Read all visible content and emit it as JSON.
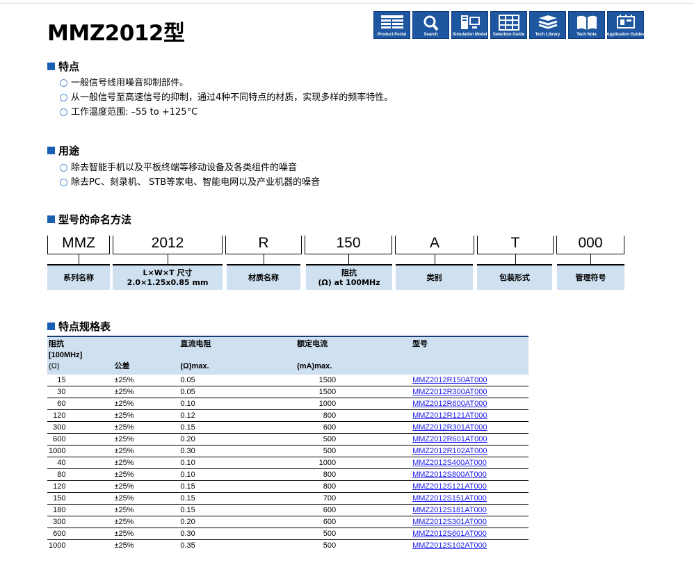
{
  "title": "MMZ2012型",
  "toolbar": [
    {
      "label": "Product Portal",
      "icon": "product-portal-icon"
    },
    {
      "label": "Search",
      "icon": "search-icon"
    },
    {
      "label": "Simulation Model",
      "icon": "simulation-icon"
    },
    {
      "label": "Selection Guide",
      "icon": "table-icon"
    },
    {
      "label": "Tech Library",
      "icon": "books-icon"
    },
    {
      "label": "Tech Note",
      "icon": "open-book-icon"
    },
    {
      "label": "Application Guides",
      "icon": "chip-icon"
    }
  ],
  "features": {
    "heading": "特点",
    "items": [
      "一般信号线用噪音抑制部件。",
      "从一般信号至高速信号的抑制，通过4种不同特点的材质，实现多样的频率特性。",
      "工作温度范围: –55 to +125°C"
    ]
  },
  "uses": {
    "heading": "用途",
    "items": [
      "除去智能手机以及平板终端等移动设备及各类组件的噪音",
      "除去PC、刻录机、 STB等家电、智能电网以及产业机器的噪音"
    ]
  },
  "naming": {
    "heading": "型号的命名方法",
    "codes": [
      "MMZ",
      "2012",
      "R",
      "150",
      "A",
      "T",
      "000"
    ],
    "labels": [
      [
        "系列名称"
      ],
      [
        "L×W×T 尺寸",
        "2.0×1.25x0.85 mm"
      ],
      [
        "材质名称"
      ],
      [
        "阻抗",
        "(Ω) at 100MHz"
      ],
      [
        "类别"
      ],
      [
        "包装形式"
      ],
      [
        "管理符号"
      ]
    ]
  },
  "spec_table": {
    "heading": "特点规格表",
    "headers": {
      "impedance": [
        "阻抗",
        "[100MHz]",
        "(Ω)"
      ],
      "tolerance": "公差",
      "dcr": [
        "直流电阻",
        "(Ω)max."
      ],
      "current": [
        "额定电流",
        "(mA)max."
      ],
      "part": "型号"
    },
    "rows": [
      [
        "15",
        "±25%",
        "0.05",
        "1500",
        "MMZ2012R150AT000"
      ],
      [
        "30",
        "±25%",
        "0.05",
        "1500",
        "MMZ2012R300AT000"
      ],
      [
        "60",
        "±25%",
        "0.10",
        "1000",
        "MMZ2012R600AT000"
      ],
      [
        "120",
        "±25%",
        "0.12",
        "800",
        "MMZ2012R121AT000"
      ],
      [
        "300",
        "±25%",
        "0.15",
        "600",
        "MMZ2012R301AT000"
      ],
      [
        "600",
        "±25%",
        "0.20",
        "500",
        "MMZ2012R601AT000"
      ],
      [
        "1000",
        "±25%",
        "0.30",
        "500",
        "MMZ2012R102AT000"
      ],
      [
        "40",
        "±25%",
        "0.10",
        "1000",
        "MMZ2012S400AT000"
      ],
      [
        "80",
        "±25%",
        "0.10",
        "800",
        "MMZ2012S800AT000"
      ],
      [
        "120",
        "±25%",
        "0.15",
        "800",
        "MMZ2012S121AT000"
      ],
      [
        "150",
        "±25%",
        "0.15",
        "700",
        "MMZ2012S151AT000"
      ],
      [
        "180",
        "±25%",
        "0.15",
        "600",
        "MMZ2012S181AT000"
      ],
      [
        "300",
        "±25%",
        "0.20",
        "600",
        "MMZ2012S301AT000"
      ],
      [
        "600",
        "±25%",
        "0.30",
        "500",
        "MMZ2012S601AT000"
      ],
      [
        "1000",
        "±25%",
        "0.35",
        "500",
        "MMZ2012S102AT000"
      ]
    ]
  },
  "colors": {
    "accent": "#1a5fb4",
    "header_bg": "#cfe0f0",
    "link": "#1a1aee",
    "toolbar_bg": "#1e56a0"
  }
}
